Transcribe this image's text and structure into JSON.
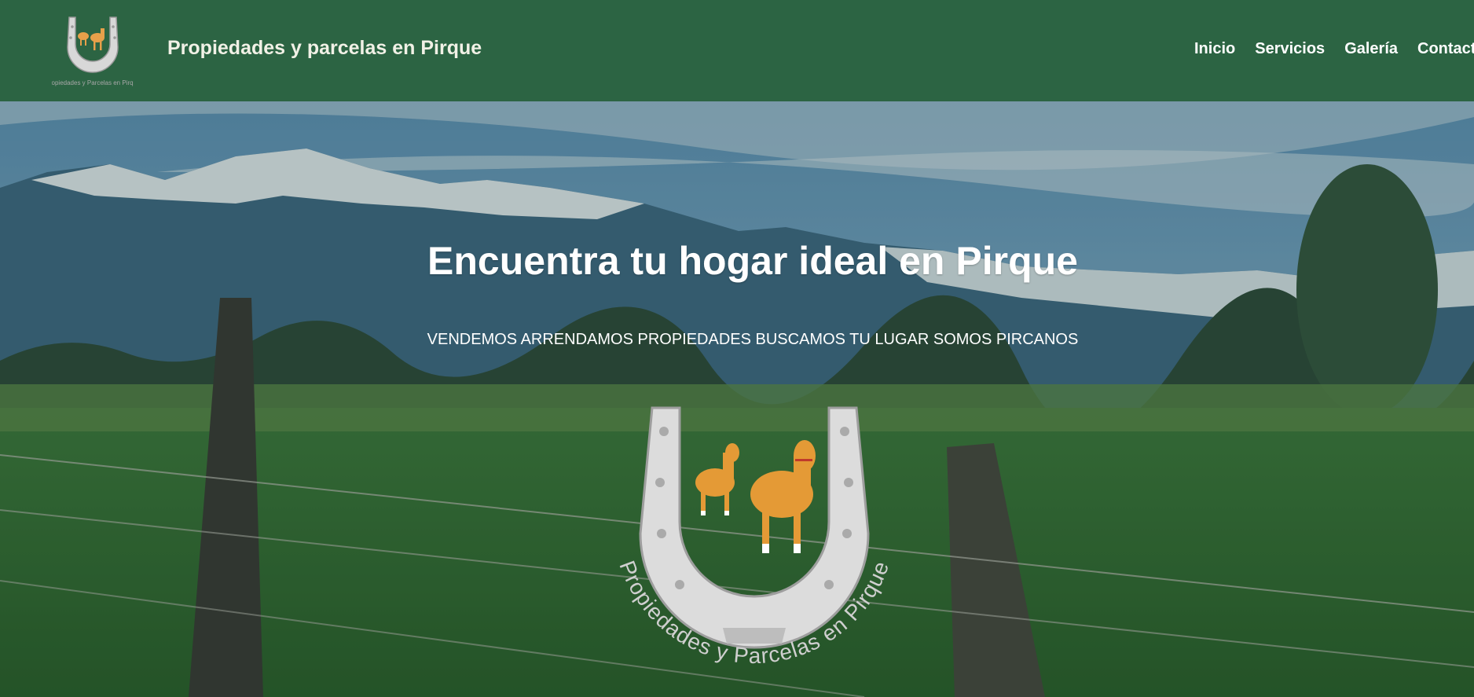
{
  "header": {
    "logo_name": "horseshoe-horses-logo",
    "site_title": "Propiedades y parcelas en Pirque"
  },
  "nav": {
    "items": [
      {
        "label": "Inicio"
      },
      {
        "label": "Servicios"
      },
      {
        "label": "Galería"
      },
      {
        "label": "Contacto"
      }
    ]
  },
  "hero": {
    "title": "Encuentra tu hogar ideal en Pirque",
    "subtitle": "VENDEMOS ARRENDAMOS PROPIEDADES BUSCAMOS TU LUGAR SOMOS PIRCANOS",
    "logo_caption": "Propiedades y Parcelas en Pirque"
  },
  "colors": {
    "header_bg": "#2c6443",
    "title_text": "#f1f1e6",
    "nav_text": "#ffffff"
  }
}
